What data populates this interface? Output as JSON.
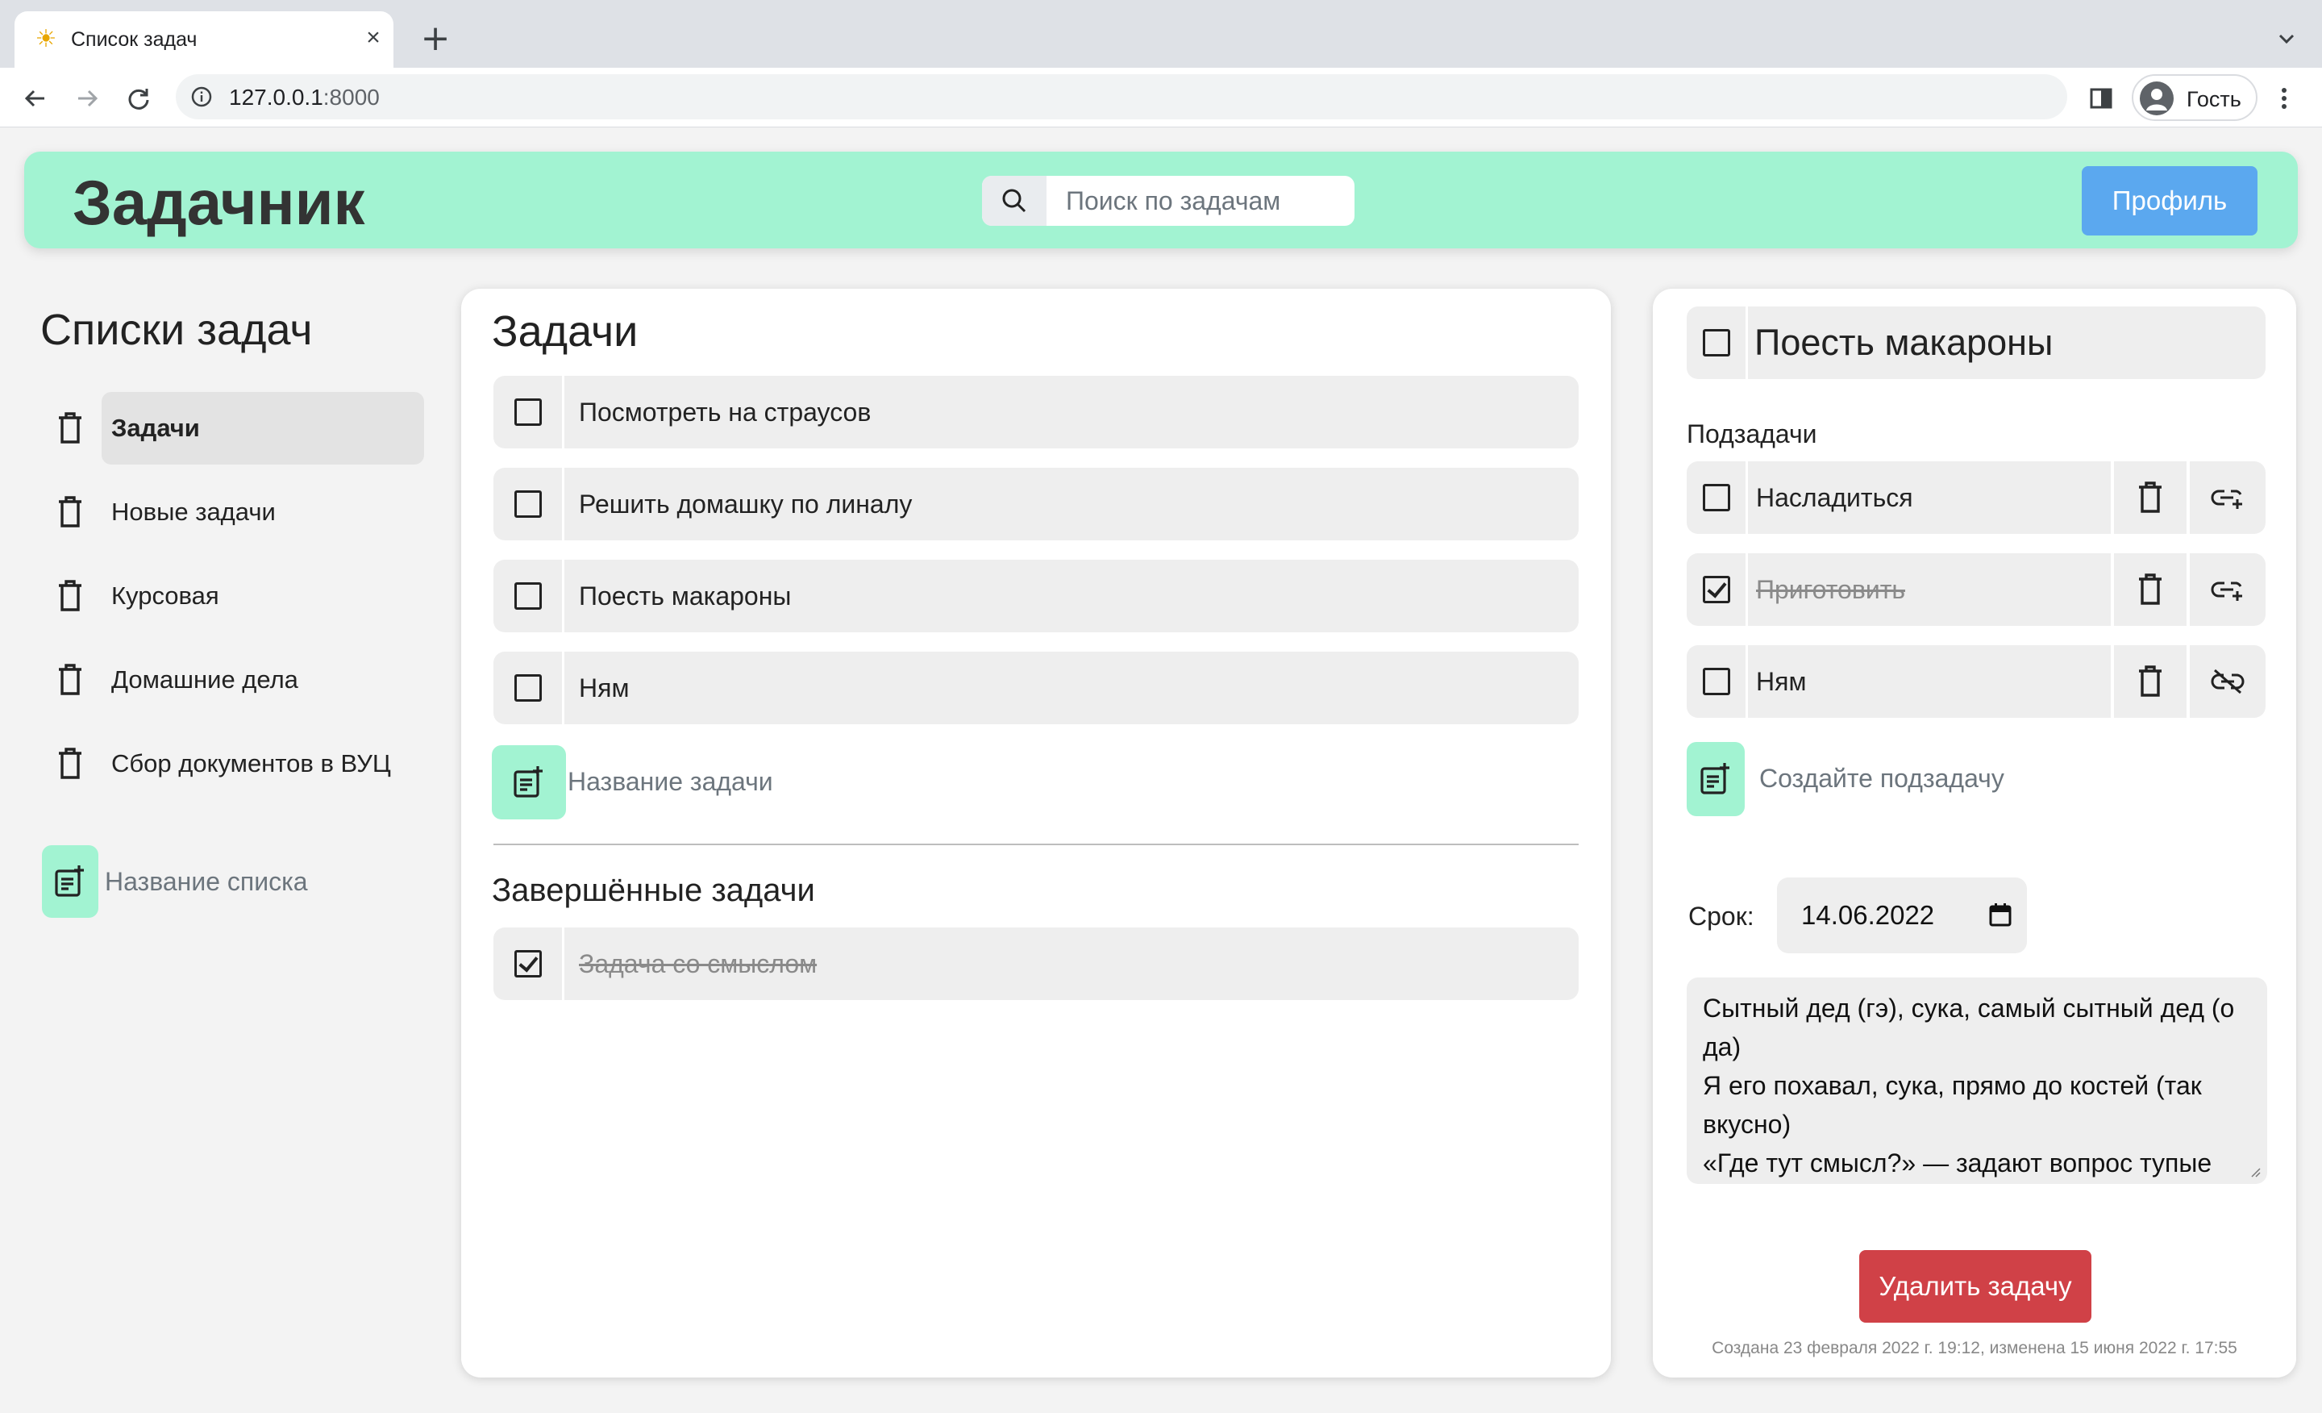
{
  "browser": {
    "tab_title": "Список задач",
    "url_host": "127.0.0.1",
    "url_port": ":8000",
    "profile_label": "Гость"
  },
  "header": {
    "logo": "Задачник",
    "search_placeholder": "Поиск по задачам",
    "profile_button": "Профиль"
  },
  "sidebar": {
    "title": "Списки задач",
    "lists": [
      {
        "label": "Задачи",
        "active": true
      },
      {
        "label": "Новые задачи",
        "active": false
      },
      {
        "label": "Курсовая",
        "active": false
      },
      {
        "label": "Домашние дела",
        "active": false
      },
      {
        "label": "Сбор документов в ВУЦ",
        "active": false
      }
    ],
    "new_list_placeholder": "Название списка"
  },
  "tasks": {
    "title": "Задачи",
    "items": [
      {
        "label": "Посмотреть на страусов",
        "done": false
      },
      {
        "label": "Решить домашку по линалу",
        "done": false
      },
      {
        "label": "Поесть макароны",
        "done": false
      },
      {
        "label": "Ням",
        "done": false
      }
    ],
    "new_task_placeholder": "Название задачи",
    "completed_title": "Завершённые задачи",
    "completed": [
      {
        "label": "Задача со смыслом",
        "done": true
      }
    ]
  },
  "detail": {
    "title": "Поесть макароны",
    "done": false,
    "subtasks_title": "Подзадачи",
    "subtasks": [
      {
        "label": "Насладиться",
        "done": false,
        "link_icon": "link-add-icon"
      },
      {
        "label": "Приготовить",
        "done": true,
        "link_icon": "link-add-icon"
      },
      {
        "label": "Ням",
        "done": false,
        "link_icon": "link-off-icon"
      }
    ],
    "new_subtask_placeholder": "Создайте подзадачу",
    "deadline_label": "Срок:",
    "deadline_value": "14.06.2022",
    "description": "Сытный дед (гэ), сука, самый сытный дед (о да)\nЯ его похавал, сука, прямо до костей (так вкусно)\n«Где тут смысл?» — задают вопрос тупые",
    "delete_button": "Удалить задачу",
    "meta": "Создана 23 февраля 2022 г. 19:12, изменена 15 июня 2022 г. 17:55"
  },
  "colors": {
    "header_bg": "#a2f3d2",
    "profile_button": "#5ba8ef",
    "delete_button": "#d04147"
  }
}
